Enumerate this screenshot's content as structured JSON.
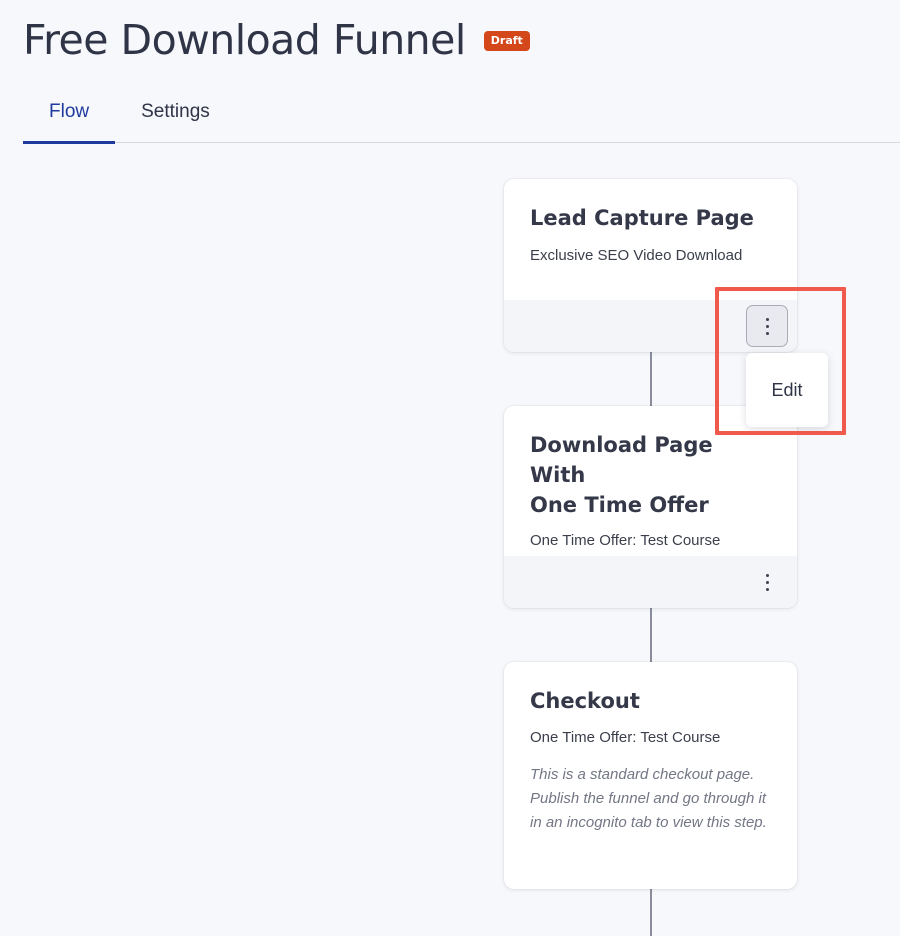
{
  "header": {
    "title": "Free Download Funnel",
    "badge": "Draft"
  },
  "tabs": [
    {
      "label": "Flow",
      "active": true
    },
    {
      "label": "Settings",
      "active": false
    }
  ],
  "steps": [
    {
      "title": "Lead Capture Page",
      "subtitle": "Exclusive SEO Video Download"
    },
    {
      "title_line1": "Download Page With",
      "title_line2": "One Time Offer",
      "subtitle": "One Time Offer: Test Course"
    },
    {
      "title": "Checkout",
      "subtitle": "One Time Offer: Test Course",
      "note": "This is a standard checkout page. Publish the funnel and go through it in an incognito tab to view this step."
    }
  ],
  "menu": {
    "items": [
      {
        "label": "Edit"
      }
    ]
  },
  "icons": {
    "step_menu": "more-vertical-icon"
  },
  "colors": {
    "accent": "#1f3a9e",
    "badge": "#d4471b",
    "highlight": "#ef5a4c"
  }
}
